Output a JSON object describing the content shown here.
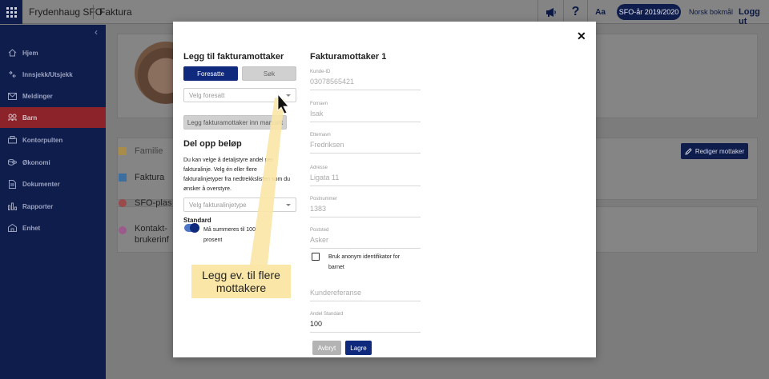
{
  "topbar": {
    "app_title": "Frydenhaug SFO",
    "page_title": "Faktura",
    "help": "?",
    "font_size": "Aa",
    "year": "SFO-år 2019/2020",
    "language": "Norsk bokmål",
    "logout": "Logg ut"
  },
  "sidebar": {
    "items": [
      {
        "label": "Hjem",
        "icon": "home-icon"
      },
      {
        "label": "Innsjekk/Utsjekk",
        "icon": "checkin-icon"
      },
      {
        "label": "Meldinger",
        "icon": "mail-icon"
      },
      {
        "label": "Barn",
        "icon": "children-icon"
      },
      {
        "label": "Kontorpulten",
        "icon": "desk-icon"
      },
      {
        "label": "Økonomi",
        "icon": "coins-icon"
      },
      {
        "label": "Dokumenter",
        "icon": "document-icon"
      },
      {
        "label": "Rapporter",
        "icon": "report-icon"
      },
      {
        "label": "Enhet",
        "icon": "building-icon"
      }
    ],
    "active_index": 3
  },
  "background": {
    "rows": [
      "Familie",
      "Faktura",
      "SFO-plas",
      "Kontakt-\nbrukerinf"
    ],
    "edit_button": "Rediger mottaker"
  },
  "modal": {
    "left_title": "Legg til fakturamottaker",
    "tab_guardian": "Foresatte",
    "tab_search": "Søk",
    "select_guardian_placeholder": "Velg foresatt",
    "manual_button": "Legg fakturamottaker inn manuelt",
    "split_title": "Del opp beløp",
    "split_desc": "Du kan velge å detaljstyre andel per fakturalinje. Velg én eller flere fakturalinjetyper fra nedtrekkslisten som du ønsker å overstyre.",
    "select_line_placeholder": "Velg fakturalinjetype",
    "standard_label": "Standard",
    "standard_text": "Må summeres til 100 prosent",
    "right_title": "Fakturamottaker 1",
    "fields": [
      {
        "label": "Kunde-ID",
        "value": "03078565421"
      },
      {
        "label": "Fornavn",
        "value": "Isak"
      },
      {
        "label": "Etternavn",
        "value": "Fredriksen"
      },
      {
        "label": "Adresse",
        "value": "Ligata 11"
      },
      {
        "label": "Postnummer",
        "value": "1383"
      },
      {
        "label": "Poststed",
        "value": "Asker"
      }
    ],
    "anon_checkbox": "Bruk anonym identifikator for barnet",
    "customer_ref_placeholder": "Kundereferanse",
    "share_label": "Andel Standard",
    "share_value": "100",
    "cancel": "Avbryt",
    "save": "Lagre"
  },
  "annotation": {
    "text": "Legg ev. til flere mottakere"
  },
  "colors": {
    "navy": "#0f1d4d",
    "primary": "#0f2a7d",
    "active_nav": "#8c222a",
    "tip": "#fae6a6"
  }
}
